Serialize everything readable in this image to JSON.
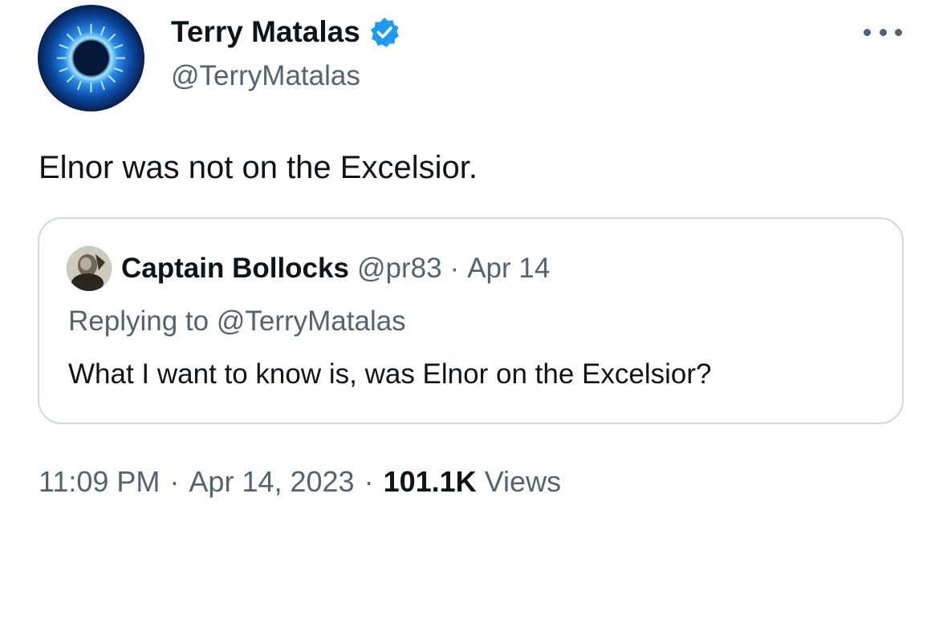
{
  "author": {
    "name": "Terry Matalas",
    "handle": "@TerryMatalas",
    "verified": true,
    "avatar_icon": "blue-ring-portal-avatar",
    "verified_icon": "verified-badge-icon",
    "verified_color": "#1d9bf0"
  },
  "menu_icon": "more-options-icon",
  "tweet": {
    "text": "Elnor was not on the Excelsior."
  },
  "quote": {
    "name": "Captain Bollocks",
    "handle": "@pr83",
    "separator": "·",
    "date": "Apr 14",
    "replying_to": "Replying to @TerryMatalas",
    "text": "What I want to know is, was Elnor on the Excelsior?",
    "avatar_icon": "user-photo-avatar"
  },
  "meta": {
    "time": "11:09 PM",
    "separator1": "·",
    "date": "Apr 14, 2023",
    "separator2": "·",
    "views_count": "101.1K",
    "views_label": "Views"
  },
  "colors": {
    "text_primary": "#0f1419",
    "text_secondary": "#536471",
    "border": "#cfd9de",
    "accent": "#1d9bf0"
  }
}
